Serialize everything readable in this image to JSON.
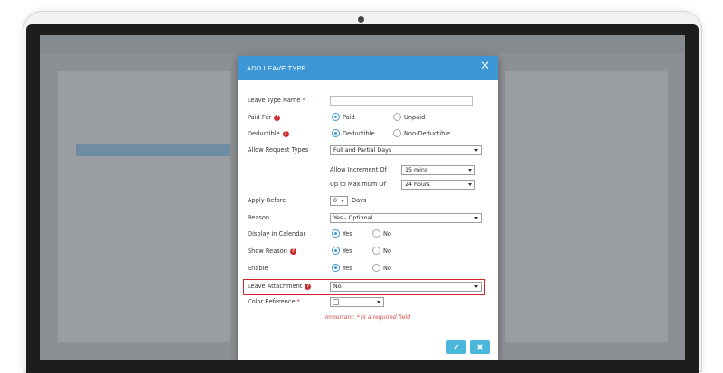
{
  "modal": {
    "title": "ADD LEAVE TYPE",
    "close_icon": "close-icon",
    "accent_color": "#3d96d6"
  },
  "form": {
    "leave_type_name": {
      "label": "Leave Type Name",
      "required_mark": "*",
      "value": ""
    },
    "paid_for": {
      "label": "Paid For",
      "options": [
        "Paid",
        "Unpaid"
      ],
      "selected": "Paid"
    },
    "deductible": {
      "label": "Deductible",
      "options": [
        "Deductible",
        "Non-Deductible"
      ],
      "selected": "Deductible"
    },
    "allow_request_types": {
      "label": "Allow Request Types",
      "value": "Full and Partial Days"
    },
    "allow_increment_of": {
      "label": "Allow Increment Of",
      "value": "15 mins"
    },
    "up_to_maximum_of": {
      "label": "Up to Maximum Of",
      "value": "24 hours"
    },
    "apply_before": {
      "label": "Apply Before",
      "value": "0",
      "unit": "Days"
    },
    "reason": {
      "label": "Reason",
      "value": "Yes - Optional"
    },
    "display_in_calendar": {
      "label": "Display in Calendar",
      "options": [
        "Yes",
        "No"
      ],
      "selected": "Yes"
    },
    "show_reason": {
      "label": "Show Reason",
      "options": [
        "Yes",
        "No"
      ],
      "selected": "Yes"
    },
    "enable": {
      "label": "Enable",
      "options": [
        "Yes",
        "No"
      ],
      "selected": "Yes"
    },
    "leave_attachment": {
      "label": "Leave Attachment",
      "value": "No"
    },
    "color_reference": {
      "label": "Color Reference",
      "required_mark": "*",
      "value": ""
    }
  },
  "important_note": "Important: * is a required field",
  "buttons": {
    "save_icon": "✔",
    "cancel_icon": "✖",
    "color": "#4ab6da"
  }
}
